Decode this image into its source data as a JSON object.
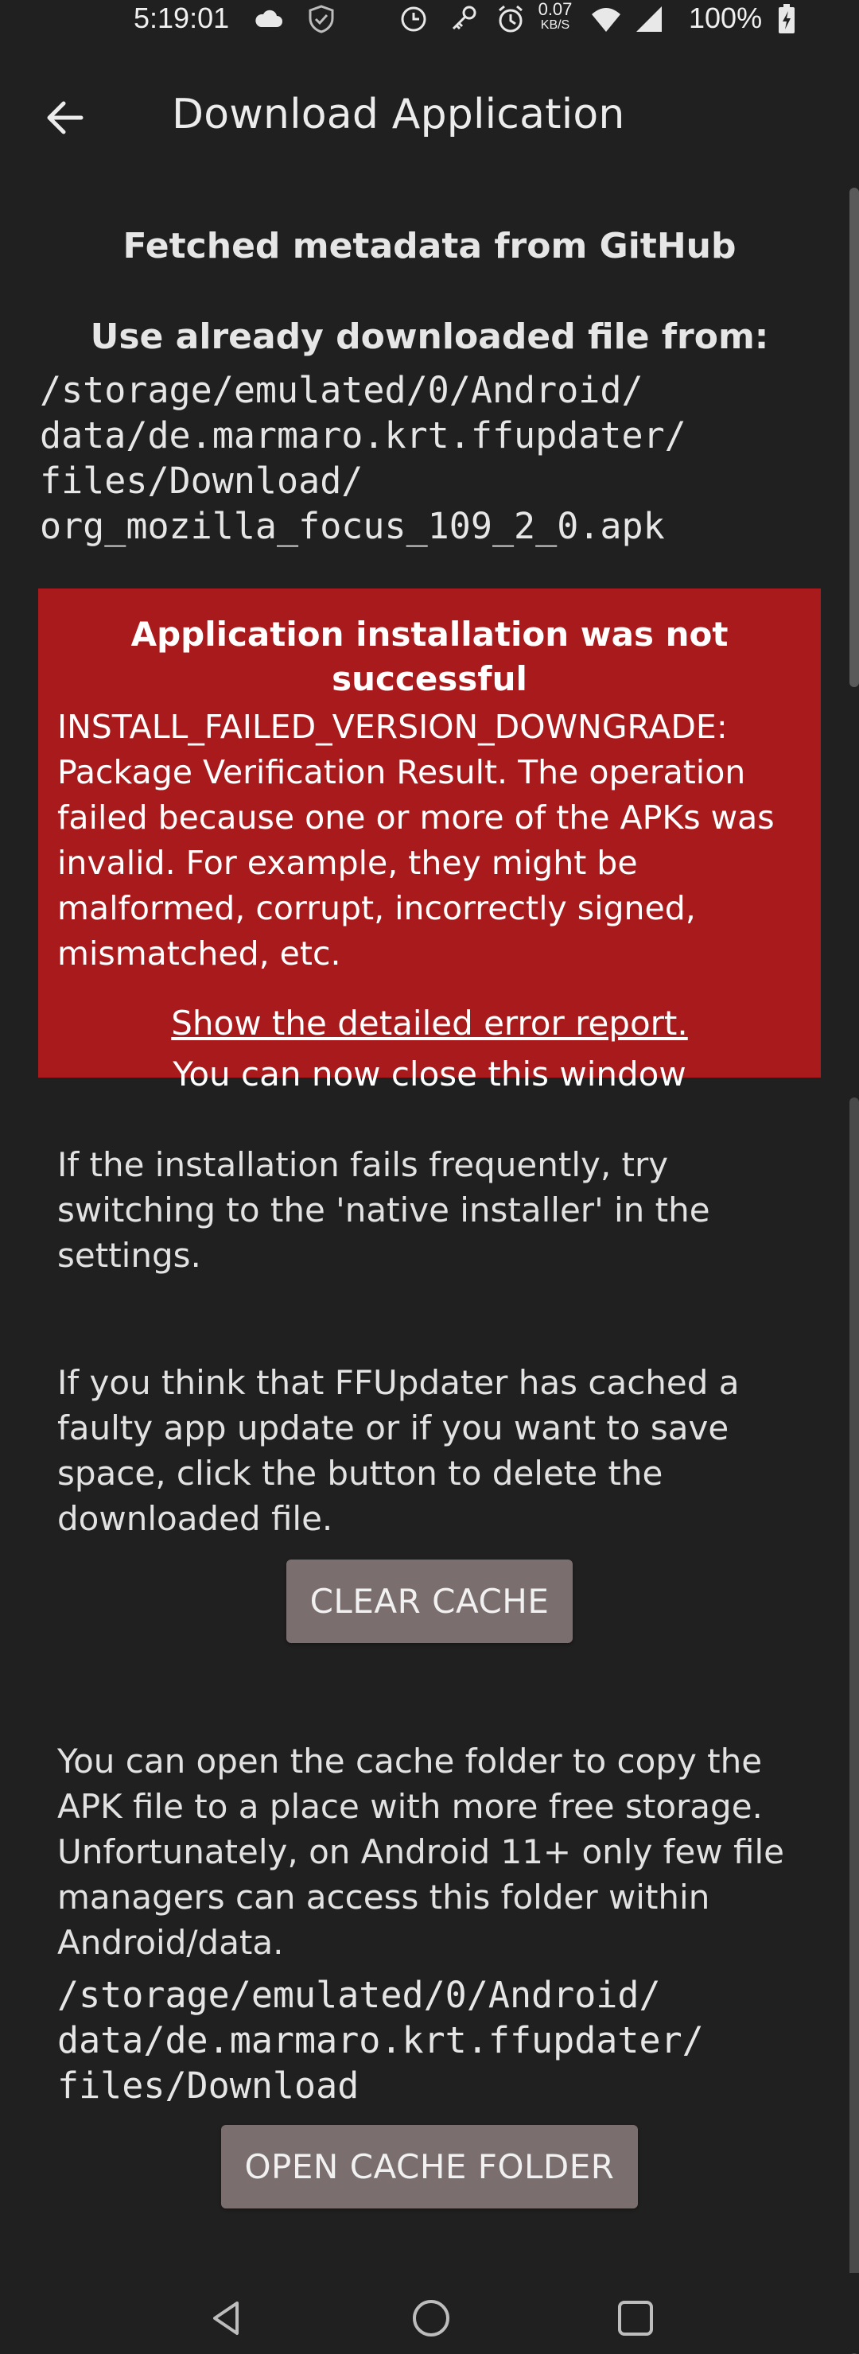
{
  "status_bar": {
    "time": "5:19:01",
    "network_speed_value": "0.07",
    "network_speed_unit": "KB/S",
    "battery": "100%",
    "icons": [
      "cloud-icon",
      "shield-icon",
      "sync-icon",
      "key-icon",
      "alarm-icon",
      "wifi-icon",
      "signal-icon",
      "battery-charging-icon"
    ]
  },
  "app_bar": {
    "title": "Download Application",
    "back_icon": "arrow-back-icon"
  },
  "main": {
    "fetched_heading": "Fetched metadata from GitHub",
    "use_file_heading": "Use already downloaded file from:",
    "file_path_lines": [
      "/storage/emulated/0/Android/",
      "data/de.marmaro.krt.ffupdater/",
      "files/Download/",
      "org_mozilla_focus_109_2_0.apk"
    ],
    "error": {
      "title": "Application installation was not successful",
      "message": "INSTALL_FAILED_VERSION_DOWNGRADE: Package Verification Result. The operation failed because one or more of the APKs was invalid. For example, they might be malformed, corrupt, incorrectly signed, mismatched, etc.",
      "details_link": "Show the detailed error report.",
      "close_hint": "You can now close this window",
      "background_color": "#a91a1c"
    },
    "native_installer_tip": "If the installation fails frequently, try switching to the 'native installer' in the settings.",
    "cache_tip": "If you think that FFUpdater has cached a faulty app update or if you want to save space, click the button to delete the downloaded file.",
    "clear_cache_label": "CLEAR CACHE",
    "cache_folder_tip": "You can open the cache folder to copy the APK file to a place with more free storage. Unfortunately, on Android 11+ only few file managers can access this folder within Android/data.",
    "cache_folder_path_lines": [
      "/storage/emulated/0/Android/",
      "data/de.marmaro.krt.ffupdater/",
      "files/Download"
    ],
    "open_cache_folder_label": "OPEN CACHE FOLDER"
  },
  "nav_bar": {
    "icons": [
      "nav-back-icon",
      "nav-home-icon",
      "nav-recents-icon"
    ]
  },
  "colors": {
    "background": "#202020",
    "button": "#7b6e6e",
    "error_red": "#a91a1c"
  }
}
